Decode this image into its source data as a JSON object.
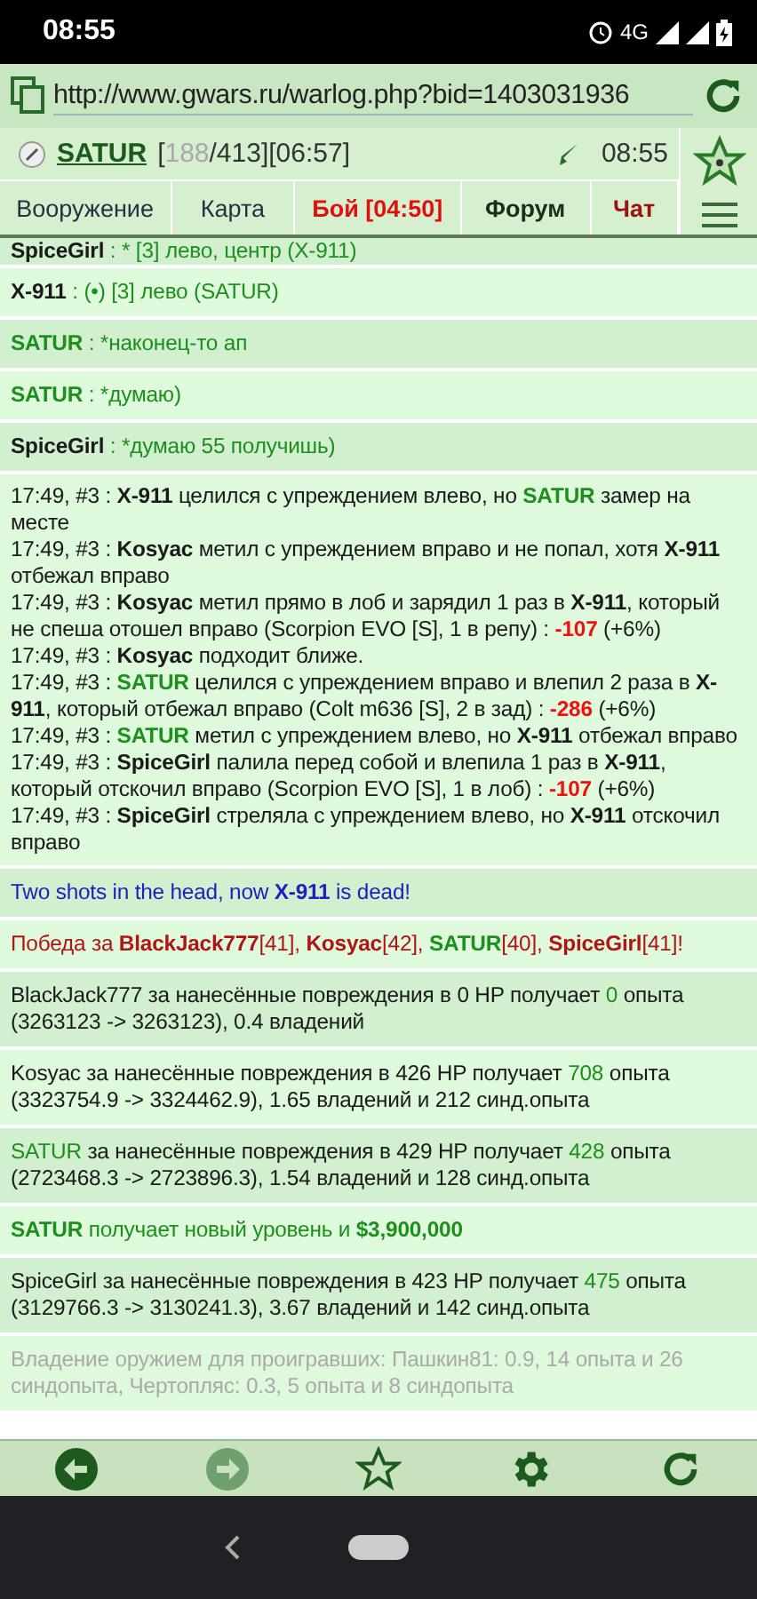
{
  "status_bar": {
    "time": "08:55",
    "network": "4G"
  },
  "url_bar": {
    "url": "http://www.gwars.ru/warlog.php?bid=1403031936"
  },
  "header": {
    "user": "SATUR",
    "hp_open": "[",
    "hp_current": "188",
    "hp_rest": "/413][06:57]",
    "time": "08:55"
  },
  "tabs": [
    {
      "label": "Вооружение",
      "kind": "plain"
    },
    {
      "label": "Карта",
      "kind": "plain"
    },
    {
      "label": "Бой [04:50]",
      "kind": "alert"
    },
    {
      "label": "Форум",
      "kind": "bold"
    },
    {
      "label": "Чат",
      "kind": "hot"
    }
  ],
  "messages": [
    {
      "kind": "chat",
      "lines": [
        [
          {
            "text": "SpiceGirl",
            "kind": "name"
          },
          {
            "text": " : * [3] лево, центр (X-911)",
            "kind": "plain"
          }
        ]
      ]
    },
    {
      "kind": "chat",
      "lines": [
        [
          {
            "text": "X-911",
            "kind": "name"
          },
          {
            "text": " : (•) [3] лево (SATUR)",
            "kind": "plain"
          }
        ]
      ]
    },
    {
      "kind": "chat",
      "lines": [
        [
          {
            "text": "SATUR",
            "kind": "ally"
          },
          {
            "text": " : *наконец-то ап",
            "kind": "plain"
          }
        ]
      ]
    },
    {
      "kind": "chat",
      "lines": [
        [
          {
            "text": "SATUR",
            "kind": "ally"
          },
          {
            "text": " : *думаю)",
            "kind": "plain"
          }
        ]
      ]
    },
    {
      "kind": "chat",
      "lines": [
        [
          {
            "text": "SpiceGirl",
            "kind": "name"
          },
          {
            "text": " : *думаю 55 получишь)",
            "kind": "plain"
          }
        ]
      ]
    },
    {
      "kind": "log",
      "lines": [
        [
          {
            "text": "17:49, #3 : ",
            "kind": "plain"
          },
          {
            "text": "X-911",
            "kind": "name"
          },
          {
            "text": " целился с упреждением влево, но ",
            "kind": "plain"
          },
          {
            "text": "SATUR",
            "kind": "ally"
          },
          {
            "text": " замер на месте",
            "kind": "plain"
          }
        ],
        [
          {
            "text": "17:49, #3 : ",
            "kind": "plain"
          },
          {
            "text": "Kosyac",
            "kind": "name"
          },
          {
            "text": " метил с упреждением вправо и не попал, хотя ",
            "kind": "plain"
          },
          {
            "text": "X-911",
            "kind": "name"
          },
          {
            "text": " отбежал вправо",
            "kind": "plain"
          }
        ],
        [
          {
            "text": "17:49, #3 : ",
            "kind": "plain"
          },
          {
            "text": "Kosyac",
            "kind": "name"
          },
          {
            "text": " метил прямо в лоб и зарядил 1 раз в ",
            "kind": "plain"
          },
          {
            "text": "X-911",
            "kind": "name"
          },
          {
            "text": ", который не спеша отошел вправо (Scorpion EVO [S], 1 в репу) : ",
            "kind": "plain"
          },
          {
            "text": "-107",
            "kind": "damage"
          },
          {
            "text": " (+6%)",
            "kind": "plain"
          }
        ],
        [
          {
            "text": "17:49, #3 : ",
            "kind": "plain"
          },
          {
            "text": "Kosyac",
            "kind": "name"
          },
          {
            "text": " подходит ближе.",
            "kind": "plain"
          }
        ],
        [
          {
            "text": "17:49, #3 : ",
            "kind": "plain"
          },
          {
            "text": "SATUR",
            "kind": "ally"
          },
          {
            "text": " целился с упреждением вправо и влепил 2 раза в ",
            "kind": "plain"
          },
          {
            "text": "X-911",
            "kind": "name"
          },
          {
            "text": ", который отбежал вправо (Colt m636 [S], 2 в зад) : ",
            "kind": "plain"
          },
          {
            "text": "-286",
            "kind": "damage"
          },
          {
            "text": " (+6%)",
            "kind": "plain"
          }
        ],
        [
          {
            "text": "17:49, #3 : ",
            "kind": "plain"
          },
          {
            "text": "SATUR",
            "kind": "ally"
          },
          {
            "text": " метил с упреждением влево, но ",
            "kind": "plain"
          },
          {
            "text": "X-911",
            "kind": "name"
          },
          {
            "text": " отбежал вправо",
            "kind": "plain"
          }
        ],
        [
          {
            "text": "17:49, #3 : ",
            "kind": "plain"
          },
          {
            "text": "SpiceGirl",
            "kind": "name"
          },
          {
            "text": " палила перед собой и влепила 1 раз в ",
            "kind": "plain"
          },
          {
            "text": "X-911",
            "kind": "name"
          },
          {
            "text": ", который отскочил вправо (Scorpion EVO [S], 1 в лоб) : ",
            "kind": "plain"
          },
          {
            "text": "-107",
            "kind": "damage"
          },
          {
            "text": " (+6%)",
            "kind": "plain"
          }
        ],
        [
          {
            "text": "17:49, #3 : ",
            "kind": "plain"
          },
          {
            "text": "SpiceGirl",
            "kind": "name"
          },
          {
            "text": " стреляла с упреждением влево, но ",
            "kind": "plain"
          },
          {
            "text": "X-911",
            "kind": "name"
          },
          {
            "text": " отскочил вправо",
            "kind": "plain"
          }
        ]
      ]
    },
    {
      "kind": "notice",
      "lines": [
        [
          {
            "text": "Two shots in the head, now ",
            "kind": "plain"
          },
          {
            "text": "X-911",
            "kind": "strong"
          },
          {
            "text": " is dead!",
            "kind": "plain"
          }
        ]
      ]
    },
    {
      "kind": "victory",
      "lines": [
        [
          {
            "text": "Победа за ",
            "kind": "plain"
          },
          {
            "text": "BlackJack777",
            "kind": "strong"
          },
          {
            "text": "[41], ",
            "kind": "plain"
          },
          {
            "text": "Kosyac",
            "kind": "strong"
          },
          {
            "text": "[42], ",
            "kind": "plain"
          },
          {
            "text": "SATUR",
            "kind": "ally"
          },
          {
            "text": "[40], ",
            "kind": "plain"
          },
          {
            "text": "SpiceGirl",
            "kind": "strong"
          },
          {
            "text": "[41]!",
            "kind": "plain"
          }
        ]
      ]
    },
    {
      "kind": "log",
      "lines": [
        [
          {
            "text": "BlackJack777 за нанесённые повреждения в 0 HP получает ",
            "kind": "plain"
          },
          {
            "text": "0",
            "kind": "gain"
          },
          {
            "text": " опыта (3263123 -> 3263123), 0.4 владений",
            "kind": "plain"
          }
        ]
      ]
    },
    {
      "kind": "log",
      "lines": [
        [
          {
            "text": "Kosyac за нанесённые повреждения в 426 HP получает ",
            "kind": "plain"
          },
          {
            "text": "708",
            "kind": "gain"
          },
          {
            "text": " опыта (3323754.9 -> 3324462.9), 1.65 владений и 212 синд.опыта",
            "kind": "plain"
          }
        ]
      ]
    },
    {
      "kind": "log",
      "lines": [
        [
          {
            "text": "SATUR",
            "kind": "gain"
          },
          {
            "text": " за нанесённые повреждения в 429 HP получает ",
            "kind": "plain"
          },
          {
            "text": "428",
            "kind": "gain"
          },
          {
            "text": " опыта (2723468.3 -> 2723896.3), 1.54 владений и 128 синд.опыта",
            "kind": "plain"
          }
        ]
      ]
    },
    {
      "kind": "reward",
      "lines": [
        [
          {
            "text": "SATUR",
            "kind": "strong"
          },
          {
            "text": " получает новый уровень и ",
            "kind": "plain"
          },
          {
            "text": "$3,900,000",
            "kind": "strong"
          }
        ]
      ]
    },
    {
      "kind": "log",
      "lines": [
        [
          {
            "text": "SpiceGirl за нанесённые повреждения в 423 HP получает ",
            "kind": "plain"
          },
          {
            "text": "475",
            "kind": "gain"
          },
          {
            "text": " опыта (3129766.3 -> 3130241.3), 3.67 владений и 142 синд.опыта",
            "kind": "plain"
          }
        ]
      ]
    },
    {
      "kind": "loser",
      "lines": [
        [
          {
            "text": "Владение оружием для проигравших: Пашкин81: 0.9, 14 опыта и 26 синдопыта, Чертопляс: 0.3, 5 опыта и 8 синдопыта",
            "kind": "plain"
          }
        ]
      ]
    }
  ],
  "toolbar": [
    {
      "kind": "back",
      "disabled": false
    },
    {
      "kind": "forward",
      "disabled": true
    },
    {
      "kind": "star",
      "disabled": false
    },
    {
      "kind": "settings",
      "disabled": false
    },
    {
      "kind": "reload",
      "disabled": false
    }
  ]
}
